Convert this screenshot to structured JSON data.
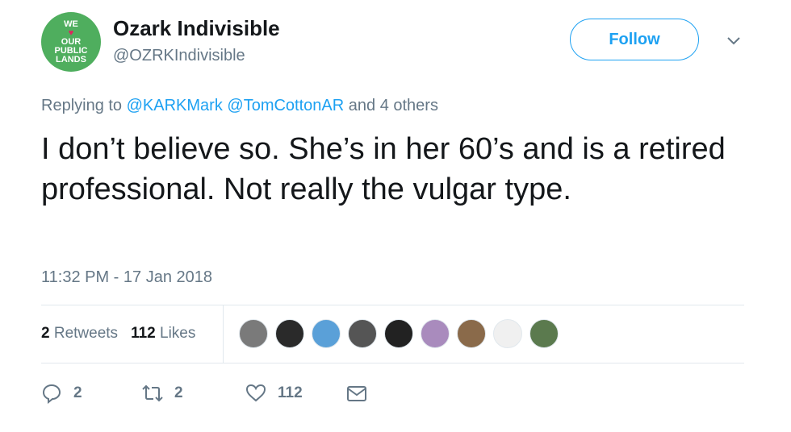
{
  "account": {
    "name": "Ozark Indivisible",
    "handle": "@OZRKIndivisible",
    "avatar_lines": [
      "WE",
      "OUR",
      "PUBLIC",
      "LANDS"
    ]
  },
  "follow_label": "Follow",
  "reply_context": {
    "prefix": "Replying to",
    "mentions": [
      "@KARKMark",
      "@TomCottonAR"
    ],
    "suffix": "and 4 others"
  },
  "tweet_text": "I don’t believe so. She’s in her 60’s and is a retired professional. Not really the vulgar type.",
  "timestamp": "11:32 PM - 17 Jan 2018",
  "stats": {
    "retweets_count": "2",
    "retweets_label": "Retweets",
    "likes_count": "112",
    "likes_label": "Likes"
  },
  "liker_avatars": [
    "#7a7a7a",
    "#2a2a2a",
    "#5aa0d8",
    "#555555",
    "#222222",
    "#a98bbd",
    "#8a6a4a",
    "#f0f0f0",
    "#5b7a4e"
  ],
  "actions": {
    "reply_count": "2",
    "retweet_count": "2",
    "like_count": "112"
  },
  "colors": {
    "accent": "#1da1f2",
    "muted": "#657786",
    "avatar_bg": "#4fae5e"
  }
}
